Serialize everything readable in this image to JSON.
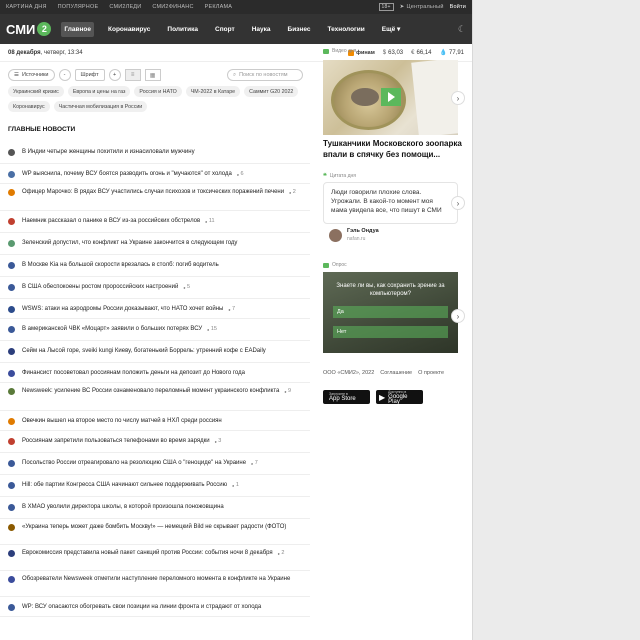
{
  "topbar": {
    "links": [
      "КАРТИНА ДНЯ",
      "ПОПУЛЯРНОЕ",
      "СМИ2ЛЕДИ",
      "СМИ2ФИНАНС",
      "РЕКЛАМА"
    ],
    "age": "18+",
    "location": "Центральный",
    "login": "Войти"
  },
  "nav": {
    "logo_text": "СМИ",
    "logo_num": "2",
    "items": [
      "Главное",
      "Коронавирус",
      "Политика",
      "Спорт",
      "Наука",
      "Бизнес",
      "Технологии",
      "Ещё ▾"
    ]
  },
  "datebar": {
    "date": "08 декабря",
    "rest": ", четверг, 13:34",
    "fin_logo": "финам",
    "usd": "63,03",
    "eur": "66,14",
    "oil": "77,91"
  },
  "toolbar": {
    "sources": "Источники",
    "minus": "-",
    "font": "Шрифт",
    "plus": "+",
    "search_placeholder": "Поиск по новостям"
  },
  "tags": [
    "Украинский кризис",
    "Европа и цены на газ",
    "Россия и НАТО",
    "ЧМ-2022 в Катаре",
    "Саммит G20 2022",
    "Коронавирус",
    "Частичная мобилизация в России"
  ],
  "main_heading": "ГЛАВНЫЕ НОВОСТИ",
  "news": [
    {
      "text": "В Индии четыре женщины похитили и изнасиловали мужчину",
      "c": "",
      "h": 22,
      "col": "#555555"
    },
    {
      "text": "WP выяснила, почему ВСУ боятся разводить огонь и \"мучаются\" от холода",
      "c": "6",
      "h": 20,
      "col": "#4a6fa5"
    },
    {
      "text": "Офицер Марочко: В рядах ВСУ участились случаи психозов и токсических поражений печени",
      "c": "2",
      "h": 27,
      "col": "#e07b00"
    },
    {
      "text": "Наемник рассказал о панике в ВСУ из-за российских обстрелов",
      "c": "11",
      "h": 22,
      "col": "#c04030"
    },
    {
      "text": "Зеленский допустил, что конфликт на Украине закончится в следующем году",
      "c": "",
      "h": 22,
      "col": "#5a9a70"
    },
    {
      "text": "В Москве Kia на большой скорости врезалась в столб: погиб водитель",
      "c": "",
      "h": 22,
      "col": "#3b5998"
    },
    {
      "text": "В США обеспокоены ростом пророссийских настроений",
      "c": "5",
      "h": 22,
      "col": "#3b5998"
    },
    {
      "text": "WSWS: атаки на аэродромы России доказывают, что НАТО хочет войны",
      "c": "7",
      "h": 20,
      "col": "#2c4c8c"
    },
    {
      "text": "В американской ЧВК «Моцарт» заявили о больших потерях ВСУ",
      "c": "15",
      "h": 22,
      "col": "#3b5998"
    },
    {
      "text": "Сейм на Лысой горе, sveiki kungi Киеву, богатенький Боррель: утренний кофе с EADaily",
      "c": "",
      "h": 22,
      "col": "#2c3e7c"
    },
    {
      "text": "Финансист посоветовал россиянам положить деньги на депозит до Нового года",
      "c": "",
      "h": 20,
      "col": "#3b4c9c"
    },
    {
      "text": "Newsweek: усиление ВС России ознаменовало переломный момент украинского конфликта",
      "c": "9",
      "h": 28,
      "col": "#5a7a3a"
    },
    {
      "text": "Овечкин вышел на второе место по числу матчей в НХЛ среди россиян",
      "c": "",
      "h": 20,
      "col": "#e07b00"
    },
    {
      "text": "Россиянам запретили пользоваться телефонами во время зарядки",
      "c": "3",
      "h": 22,
      "col": "#c04030"
    },
    {
      "text": "Посольство России отреагировало на резолюцию США о \"геноциде\" на Украине",
      "c": "7",
      "h": 22,
      "col": "#3b5998"
    },
    {
      "text": "Hill: обе партии Конгресса США начинают сильнее поддерживать Россию",
      "c": "1",
      "h": 22,
      "col": "#3b5998"
    },
    {
      "text": "В ХМАО уволили директора школы, в которой произошла поножовщина",
      "c": "",
      "h": 22,
      "col": "#3b5998"
    },
    {
      "text": "«Украина теперь может даже бомбить Москву!» — немецкий Bild не скрывает радости (ФОТО)",
      "c": "",
      "h": 26,
      "col": "#8b5a00"
    },
    {
      "text": "Еврокомиссия представила новый пакет санкций против России: события ночи 8 декабря",
      "c": "2",
      "h": 26,
      "col": "#2c3e7c"
    },
    {
      "text": "Обозреватели Newsweek отметили наступление переломного момента в конфликте на Украине",
      "c": "",
      "h": 26,
      "col": "#3b4c9c"
    },
    {
      "text": "WP: ВСУ опасаются обогревать свои позиции на линии фронта и страдают от холода",
      "c": "",
      "h": 20,
      "col": "#3b5998"
    }
  ],
  "right": {
    "video_label": "Видео дня",
    "video_title": "Тушканчики Московского зоопарка впали в спячку без помощи...",
    "quote_label": "Цитата дня",
    "quote_text": "Люди говорили плохие слова. Угрожали. В какой-то момент моя мама увидела все, что пишут в СМИ",
    "quote_author": "Гэль Ондуа",
    "quote_source": "nafan.ru",
    "poll_label": "Опрос",
    "poll_question": "Знаете ли вы, как сохранить зрение за компьютером?",
    "poll_yes": "Да",
    "poll_no": "Нет",
    "footer_copy": "ООО «СМИ2», 2022",
    "footer_agreement": "Соглашение",
    "footer_about": "О проекте",
    "app_store_small": "Загрузите в",
    "app_store": "App Store",
    "google_play_small": "Доступно в",
    "google_play": "Google Play"
  }
}
